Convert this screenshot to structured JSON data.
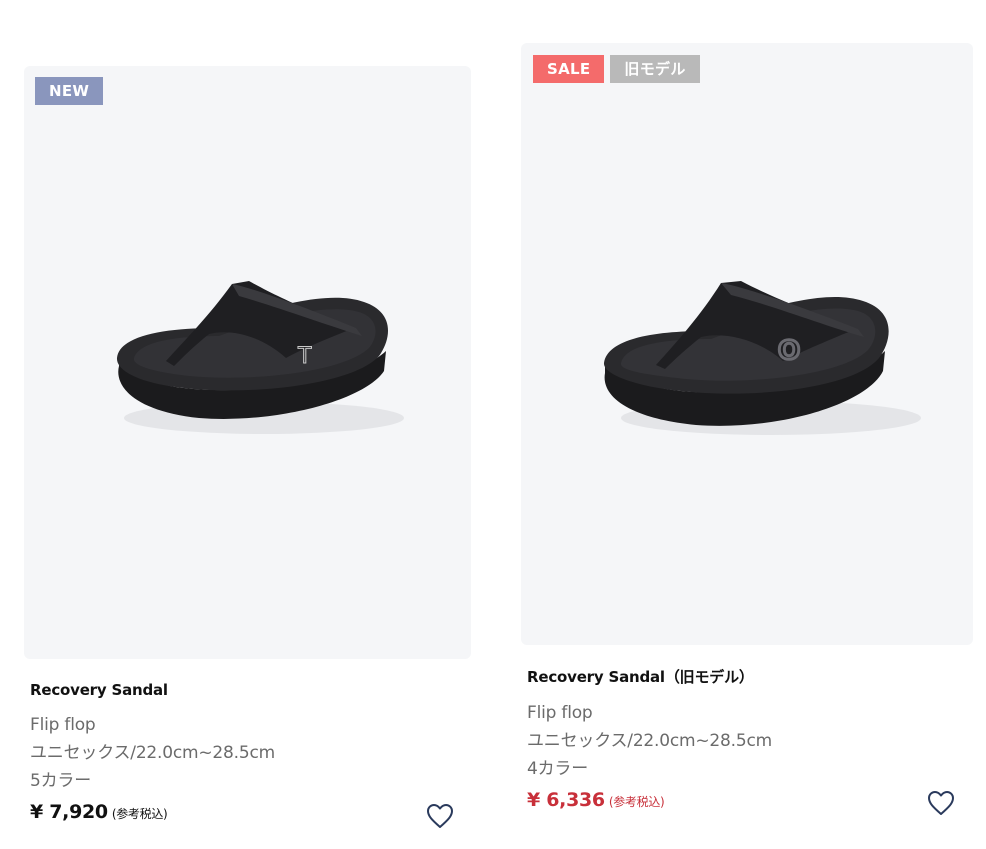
{
  "products": [
    {
      "badges": [
        {
          "label": "NEW",
          "color": "#8a96bd"
        }
      ],
      "name": "Recovery Sandal",
      "type": "Flip flop",
      "size": "ユニセックス/22.0cm~28.5cm",
      "colors": "5カラー",
      "price": "¥ 7,920",
      "price_color": "#111111",
      "tax": "(参考税込)",
      "image_icon": "black-flip-flop-sandal-image",
      "logo_mark": "T"
    },
    {
      "badges": [
        {
          "label": "SALE",
          "color": "#f46b6b"
        },
        {
          "label": "旧モデル",
          "color": "#b9b9b9"
        }
      ],
      "name": "Recovery Sandal（旧モデル）",
      "type": "Flip flop",
      "size": "ユニセックス/22.0cm~28.5cm",
      "colors": "4カラー",
      "price": "¥ 6,336",
      "price_color": "#c8303a",
      "tax": "(参考税込)",
      "image_icon": "black-flip-flop-sandal-image",
      "logo_mark": "O"
    }
  ],
  "favorite_icon": "heart-outline-icon",
  "colors": {
    "image_bg": "#f5f6f8",
    "heart": "#2a3a5c"
  }
}
